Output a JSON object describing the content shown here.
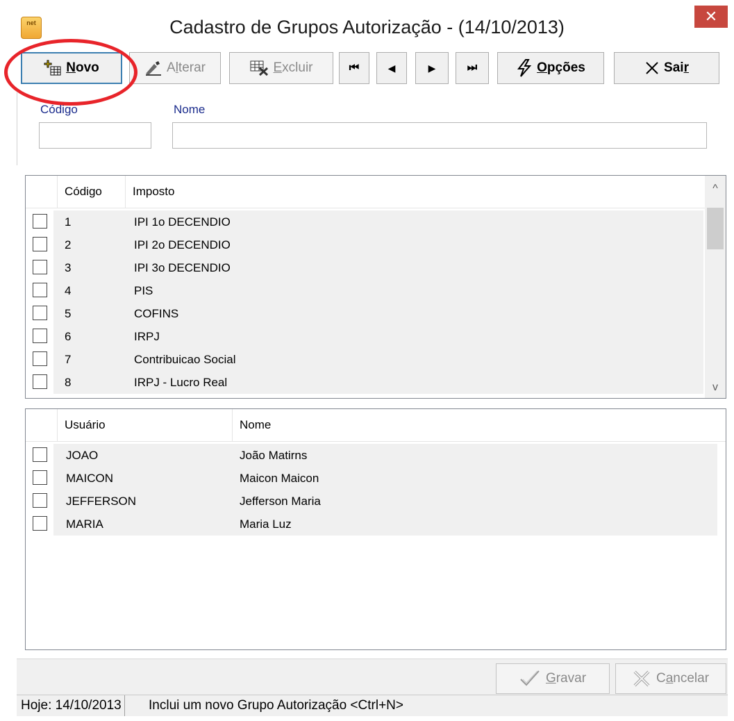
{
  "window": {
    "title": "Cadastro de Grupos Autorização - (14/10/2013)",
    "app_icon_text": "net",
    "close_glyph": "✕"
  },
  "toolbar": {
    "novo": {
      "pre": "",
      "accel": "N",
      "post": "ovo",
      "icon": "new-record-icon"
    },
    "alterar": {
      "pre": "A",
      "accel": "l",
      "post": "terar",
      "icon": "edit-icon"
    },
    "excluir": {
      "pre": "",
      "accel": "E",
      "post": "xcluir",
      "icon": "delete-icon"
    },
    "first_glyph": "⏮",
    "prev_glyph": "◀",
    "next_glyph": "▶",
    "last_glyph": "⏭",
    "opcoes": {
      "pre": "",
      "accel": "O",
      "post": "pções",
      "icon": "lightning-icon"
    },
    "sair": {
      "pre": "Sai",
      "accel": "r",
      "post": "",
      "icon": "close-x-icon"
    }
  },
  "form": {
    "codigo_label": "Código",
    "codigo_value": "",
    "nome_label": "Nome",
    "nome_value": ""
  },
  "impostos_grid": {
    "headers": {
      "codigo": "Código",
      "imposto": "Imposto"
    },
    "rows": [
      {
        "codigo": "1",
        "imposto": "IPI 1o DECENDIO",
        "checked": false
      },
      {
        "codigo": "2",
        "imposto": "IPI 2o DECENDIO",
        "checked": false
      },
      {
        "codigo": "3",
        "imposto": "IPI 3o DECENDIO",
        "checked": false
      },
      {
        "codigo": "4",
        "imposto": "PIS",
        "checked": false
      },
      {
        "codigo": "5",
        "imposto": "COFINS",
        "checked": false
      },
      {
        "codigo": "6",
        "imposto": "IRPJ",
        "checked": false
      },
      {
        "codigo": "7",
        "imposto": "Contribuicao Social",
        "checked": false
      },
      {
        "codigo": "8",
        "imposto": "IRPJ - Lucro Real",
        "checked": false
      }
    ]
  },
  "usuarios_grid": {
    "headers": {
      "usuario": "Usuário",
      "nome": "Nome"
    },
    "rows": [
      {
        "usuario": "JOAO",
        "nome": "João Matirns",
        "checked": false
      },
      {
        "usuario": "MAICON",
        "nome": "Maicon Maicon",
        "checked": false
      },
      {
        "usuario": "JEFFERSON",
        "nome": "Jefferson Maria",
        "checked": false
      },
      {
        "usuario": "MARIA",
        "nome": "Maria Luz",
        "checked": false
      }
    ]
  },
  "bottombar": {
    "gravar": {
      "pre": "",
      "accel": "G",
      "post": "ravar"
    },
    "cancelar": {
      "pre": "C",
      "accel": "a",
      "post": "ncelar"
    }
  },
  "statusbar": {
    "date": "Hoje: 14/10/2013",
    "message": "Inclui um novo Grupo Autorização <Ctrl+N>"
  },
  "colors": {
    "annotation_circle": "#e8242a",
    "label_blue": "#1a2b8c",
    "close_red": "#c7473e"
  }
}
